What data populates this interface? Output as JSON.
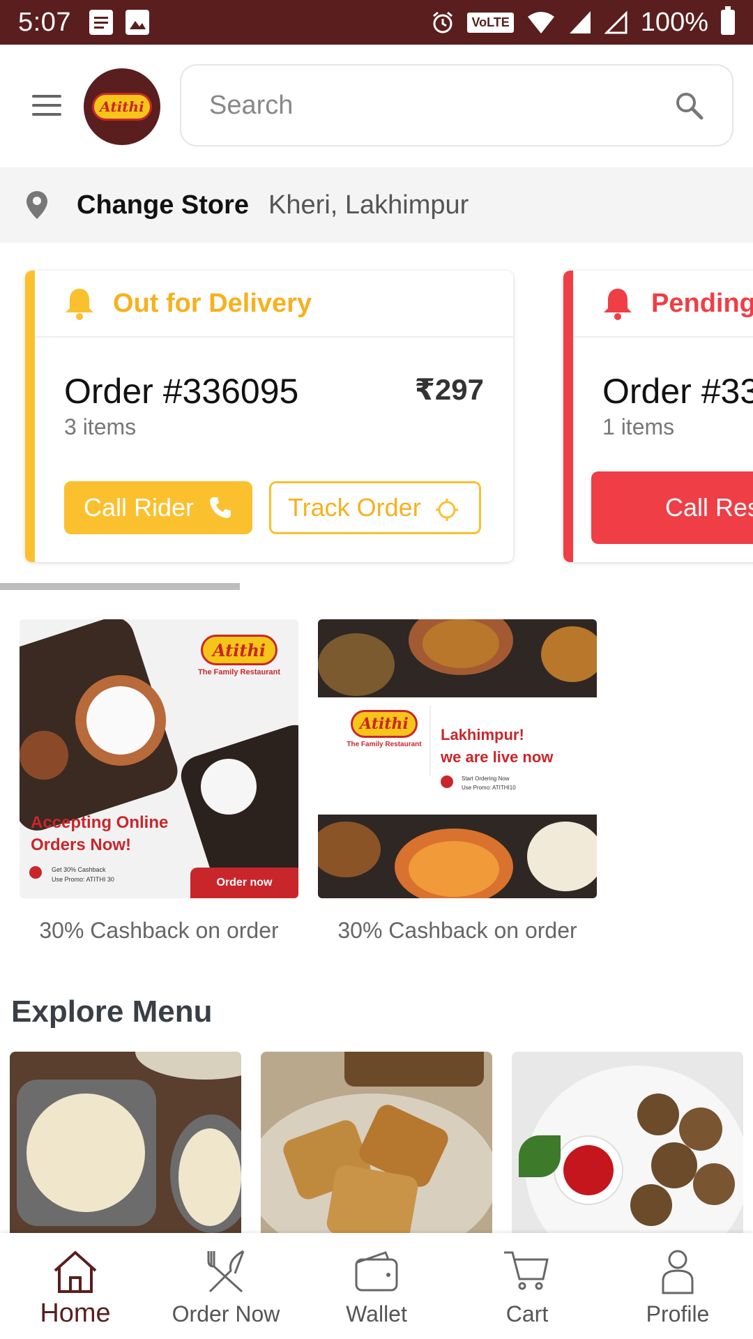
{
  "status_bar": {
    "time": "5:07",
    "volte": "VoLTE",
    "battery": "100%"
  },
  "header": {
    "logo_text": "Atithi",
    "search": {
      "placeholder": "Search"
    }
  },
  "store": {
    "label": "Change Store",
    "value": "Kheri, Lakhimpur"
  },
  "orders": [
    {
      "status": "Out for Delivery",
      "order_no": "Order #336095",
      "items": "3 items",
      "amount": "₹297",
      "primary_btn": "Call Rider",
      "secondary_btn": "Track Order",
      "accent": "#fbc02d"
    },
    {
      "status": "Pending",
      "order_no": "Order #33",
      "items": "1 items",
      "primary_btn": "Call Res",
      "accent": "#ef3e46"
    }
  ],
  "promos": [
    {
      "headline_1": "Accepting Online",
      "headline_2": "Orders Now!",
      "small_1": "Get 30% Cashback",
      "small_2": "Use Promo: ATITHI 30",
      "cta": "Order now",
      "logo_text": "Atithi",
      "logo_sub": "The Family Restaurant",
      "caption": "30% Cashback on order"
    },
    {
      "headline_1": "Lakhimpur!",
      "headline_2": "we are live now",
      "small_1": "Start Ordering Now",
      "small_2": "Use Promo: ATITHI10",
      "logo_text": "Atithi",
      "logo_sub": "The Family Restaurant",
      "caption": "30% Cashback on order"
    }
  ],
  "explore": {
    "title": "Explore Menu"
  },
  "bottom_nav": [
    {
      "label": "Home",
      "icon": "home-icon",
      "active": true
    },
    {
      "label": "Order Now",
      "icon": "fork-knife-icon",
      "active": false
    },
    {
      "label": "Wallet",
      "icon": "wallet-icon",
      "active": false
    },
    {
      "label": "Cart",
      "icon": "cart-icon",
      "active": false
    },
    {
      "label": "Profile",
      "icon": "profile-icon",
      "active": false
    }
  ],
  "colors": {
    "brand": "#5a1e1e",
    "delivery": "#fbc02d",
    "pending": "#ef3e46"
  }
}
